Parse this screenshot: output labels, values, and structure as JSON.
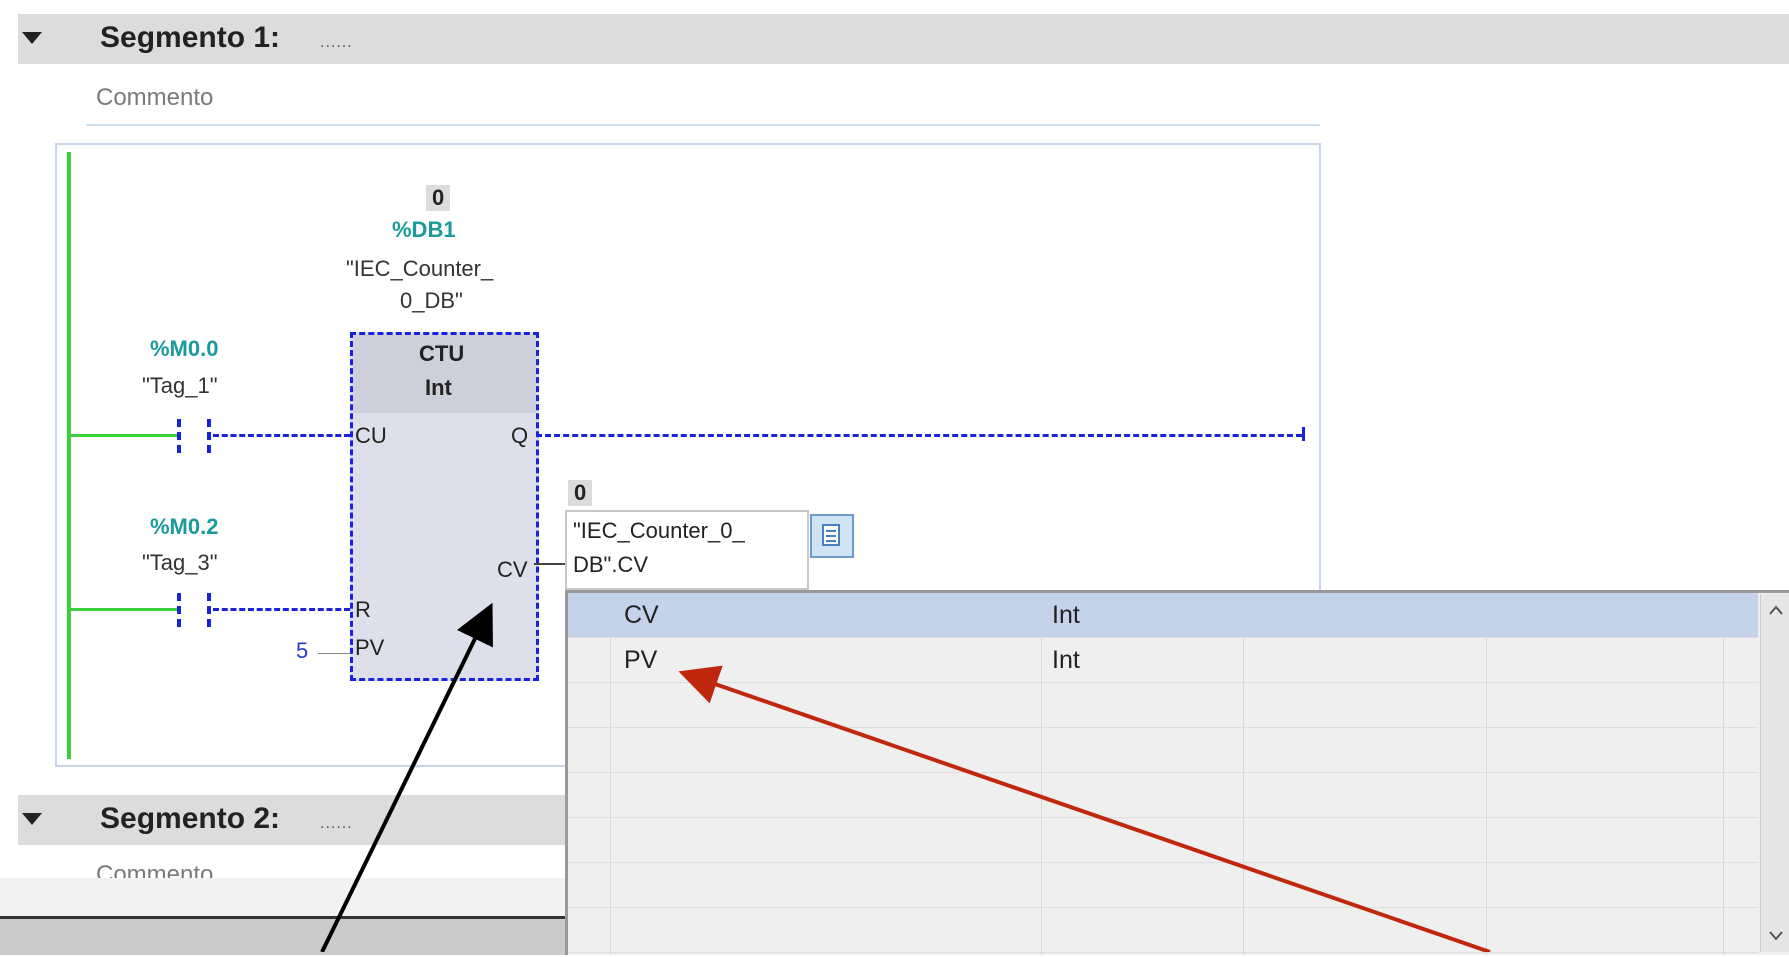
{
  "segment1": {
    "title": "Segmento 1:",
    "dots": "......",
    "comment": "Commento"
  },
  "segment2": {
    "title": "Segmento 2:",
    "dots": "......",
    "comment": "Commento"
  },
  "fb": {
    "value": "0",
    "db_address": "%DB1",
    "db_name_line1": "\"IEC_Counter_",
    "db_name_line2": "0_DB\"",
    "type": "CTU",
    "datatype": "Int",
    "pin_cu": "CU",
    "pin_q": "Q",
    "pin_cv": "CV",
    "pin_r": "R",
    "pin_pv": "PV",
    "pv_value": "5"
  },
  "contact1": {
    "address": "%M0.0",
    "name": "\"Tag_1\""
  },
  "contact2": {
    "address": "%M0.2",
    "name": "\"Tag_3\""
  },
  "cv_output": {
    "value": "0",
    "line1": "\"IEC_Counter_0_",
    "line2": "DB\".CV"
  },
  "dropdown": {
    "rows": [
      {
        "name": "CV",
        "type": "Int",
        "selected": true
      },
      {
        "name": "PV",
        "type": "Int",
        "selected": false
      }
    ]
  },
  "colors": {
    "rail": "#3ccf3c",
    "wire_blue": "#1a22dd",
    "address_teal": "#1a9a9a",
    "annotation_red": "#c0280d",
    "selection": "#c5d3ea"
  }
}
